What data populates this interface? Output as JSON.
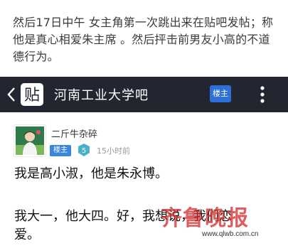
{
  "caption": {
    "text": "然后17日中午 女主角第一次跳出来在贴吧发帖；称他是真心相爱朱主席 。然后抨击前男友小高的不道德行为。"
  },
  "navbar": {
    "title": "河南工业大学吧",
    "owner_button": "楼主",
    "logo_glyph": "贴"
  },
  "post": {
    "username": "二斤牛杂碎",
    "owner_badge": "楼主",
    "level": "5",
    "time": "15小时前",
    "lines": [
      "我是高小淑，他是朱永博。",
      "我大一，他大四。好，我想说，我们恋",
      "爱。"
    ]
  },
  "watermark": {
    "text": "齐鲁晚报",
    "url": "www.qlwb.com.cn"
  },
  "colors": {
    "navbar_bg": "#232631",
    "owner_blue": "#2f6fd8",
    "badge_blue": "#3a86d8",
    "level_teal": "#49b0c8",
    "watermark_red": "#d22828"
  }
}
